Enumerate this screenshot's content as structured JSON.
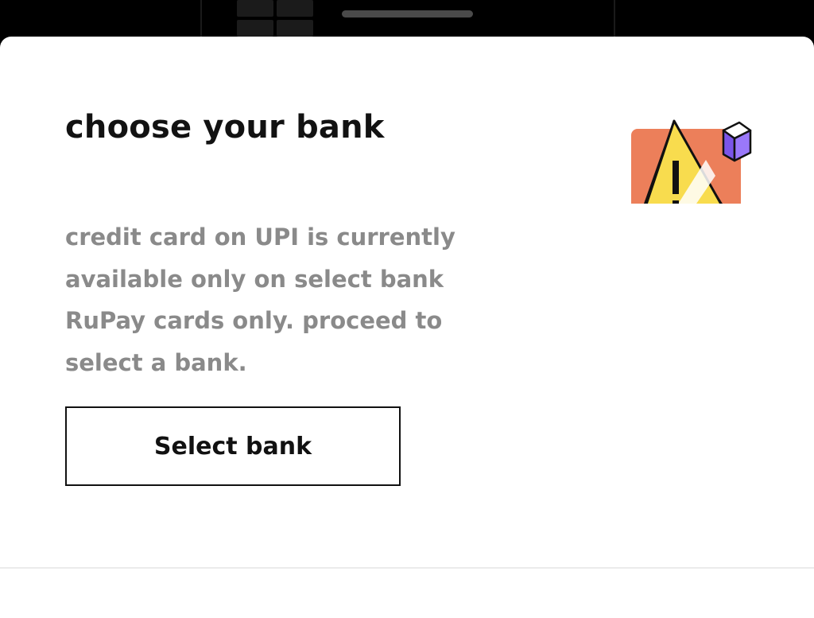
{
  "sheet": {
    "title": "choose your bank",
    "message": "credit card on UPI is currently available only on select bank RuPay cards only. proceed to select a bank.",
    "primary_button_label": "Select bank"
  },
  "illustration": {
    "icon": "warning-icon",
    "colors": {
      "card": "#EC7F5A",
      "triangle": "#F8DC4E",
      "cube": "#8A63F5",
      "outline": "#111111"
    }
  },
  "colors": {
    "title": "#121212",
    "body_text": "#8A8A8A",
    "button_border": "#111111",
    "backdrop": "#000000"
  }
}
